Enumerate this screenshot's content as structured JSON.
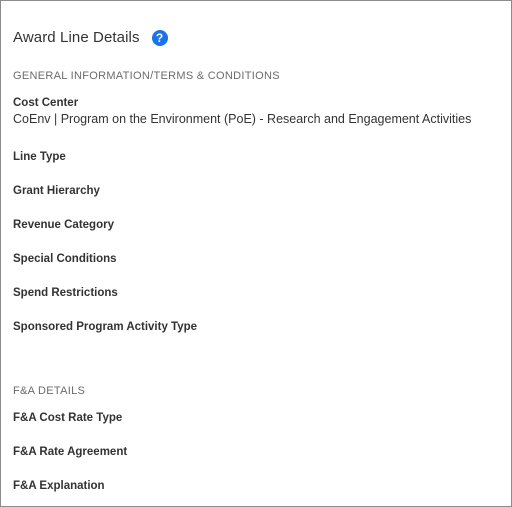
{
  "panel": {
    "title": "Award Line Details",
    "help_icon": "help-circle-icon",
    "accent_color": "#1a73e8"
  },
  "sections": {
    "general": {
      "heading": "GENERAL INFORMATION/TERMS & CONDITIONS",
      "fields": [
        {
          "label": "Cost Center",
          "value": "CoEnv | Program on the Environment (PoE) - Research and Engagement Activities"
        },
        {
          "label": "Line Type",
          "value": ""
        },
        {
          "label": "Grant Hierarchy",
          "value": ""
        },
        {
          "label": "Revenue Category",
          "value": ""
        },
        {
          "label": "Special Conditions",
          "value": ""
        },
        {
          "label": "Spend Restrictions",
          "value": ""
        },
        {
          "label": "Sponsored Program Activity Type",
          "value": ""
        }
      ]
    },
    "fa": {
      "heading": "F&A DETAILS",
      "fields": [
        {
          "label": "F&A Cost Rate Type",
          "value": ""
        },
        {
          "label": "F&A Rate Agreement",
          "value": ""
        },
        {
          "label": "F&A Explanation",
          "value": ""
        }
      ]
    }
  }
}
